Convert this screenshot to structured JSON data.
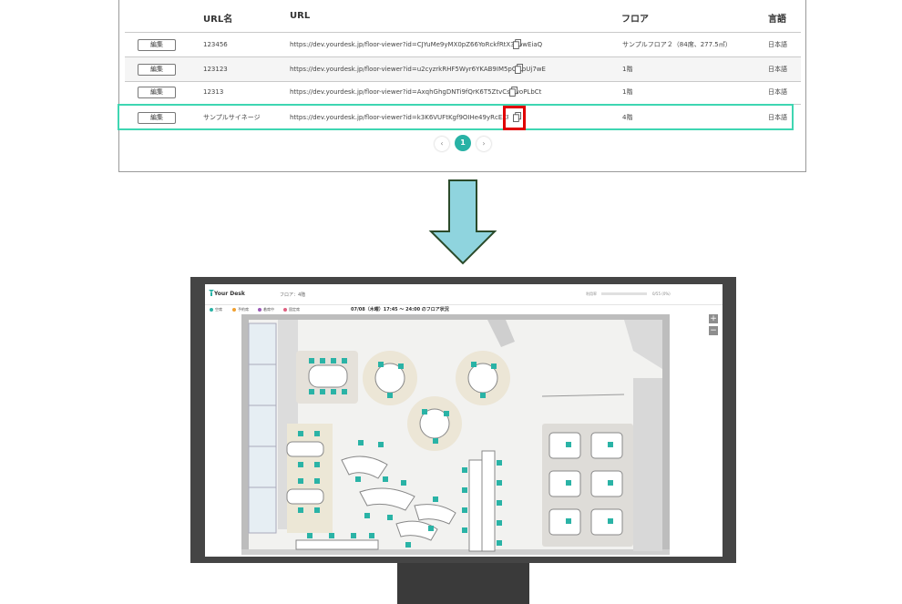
{
  "table": {
    "headers": {
      "url_name": "URL名",
      "url": "URL",
      "floor": "フロア",
      "language": "言語"
    },
    "edit_label": "編集",
    "rows": [
      {
        "name": "123456",
        "url": "https://dev.yourdesk.jp/floor-viewer?id=CJYuMe9yMX0pZ66YoRckfRtX3oowEiaQ",
        "floor": "サンプルフロア２（84席、277.5㎡）",
        "language": "日本語"
      },
      {
        "name": "123123",
        "url": "https://dev.yourdesk.jp/floor-viewer?id=u2cyzrkRHF5Wyr6YKAB9IM5pCMpUj7wE",
        "floor": "1階",
        "language": "日本語"
      },
      {
        "name": "12313",
        "url": "https://dev.yourdesk.jp/floor-viewer?id=AxqhGhgDNTi9fQrK6T5ZtvCsSwoPLbCt",
        "floor": "1階",
        "language": "日本語"
      },
      {
        "name": "サンプルサイネージ",
        "url": "https://dev.yourdesk.jp/floor-viewer?id=k3K6VUFtKgf9OIHe49yRcEXPndrmHbA",
        "floor": "4階",
        "language": "日本語"
      }
    ],
    "pagination": {
      "prev": "‹",
      "current": "1",
      "next": "›"
    }
  },
  "signage": {
    "logo": "Your Desk",
    "floor_label": "フロア：4階",
    "occupancy_label": "利用率",
    "occupancy_value": "0/55 (0%)",
    "occupancy_fraction": 0,
    "legend": [
      {
        "label": "空席",
        "color": "#2ab3a6"
      },
      {
        "label": "予約席",
        "color": "#f0a030"
      },
      {
        "label": "着席中",
        "color": "#9b59b6"
      },
      {
        "label": "固定席",
        "color": "#e06080"
      }
    ],
    "status": "07/08（木曜）17:45 ～ 24:00 のフロア状況",
    "zoom_in": "+",
    "zoom_out": "−"
  },
  "colors": {
    "selection": "#3fd6b2",
    "highlight": "#e00000",
    "arrow": "#8fd4de",
    "accent": "#28b2a5"
  }
}
